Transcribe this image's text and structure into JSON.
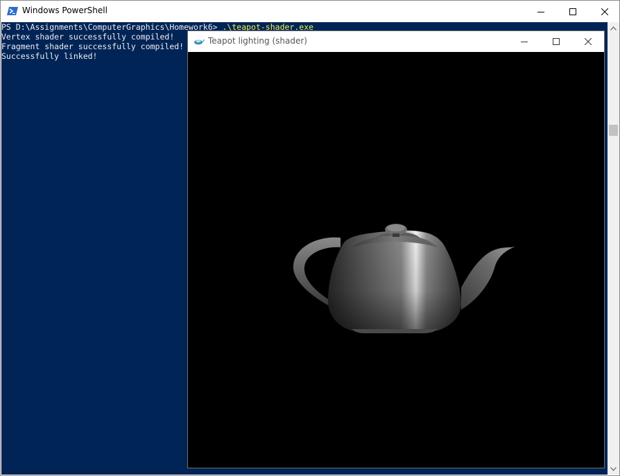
{
  "powershell": {
    "title": "Windows PowerShell",
    "console": {
      "prompt": "PS D:\\Assignments\\ComputerGraphics\\Homework6> ",
      "command": ".\\teapot-shader.exe",
      "output": [
        "Vertex shader successfully compiled!",
        "Fragment shader successfully compiled!",
        "Successfully linked!"
      ]
    }
  },
  "teapot_window": {
    "title": "Teapot lighting (shader)"
  },
  "colors": {
    "console_background": "#012456",
    "console_text": "#eeedf0",
    "command_text": "#f5f04f",
    "viewport_background": "#000000"
  },
  "icons": {
    "powershell_app": "powershell-icon",
    "teapot_app": "opengl-app-icon",
    "minimize": "minimize-icon",
    "maximize": "maximize-icon",
    "close": "close-icon"
  }
}
